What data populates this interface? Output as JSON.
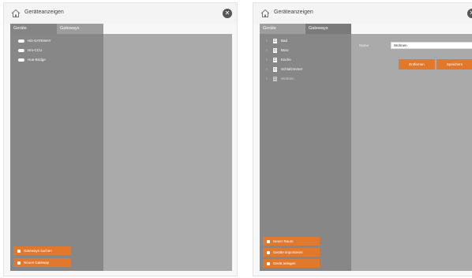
{
  "left_panel": {
    "title": "Geräteanzeigen",
    "tabs": [
      {
        "label": "Geräte",
        "active": true
      },
      {
        "label": "Gateways",
        "active": false
      }
    ],
    "devices": [
      "HD-GATEWAY",
      "Hm-CCU",
      "Hue-Bridge"
    ],
    "buttons": [
      {
        "label": "Gateways suchen"
      },
      {
        "label": "Neues Gateway"
      }
    ]
  },
  "right_panel": {
    "title": "Geräteanzeigen",
    "tabs": [
      {
        "label": "Geräte",
        "active": true
      },
      {
        "label": "Gateways",
        "active": false
      }
    ],
    "rooms": [
      {
        "label": "Bad",
        "dim": false
      },
      {
        "label": "Büro",
        "dim": false
      },
      {
        "label": "Küche",
        "dim": false
      },
      {
        "label": "Schlafzimmer",
        "dim": false
      },
      {
        "label": "Wohnen",
        "dim": true
      }
    ],
    "form": {
      "name_label": "Name",
      "name_value": "Wohnen"
    },
    "actions": {
      "remove": "Entfernen",
      "save": "Speichern"
    },
    "buttons": [
      {
        "label": "Neuer Raum"
      },
      {
        "label": "Geräte importieren"
      },
      {
        "label": "Gerät anlegen"
      }
    ]
  },
  "colors": {
    "accent": "#e2782c",
    "sidebar": "#878787",
    "content": "#aaaaaa"
  }
}
